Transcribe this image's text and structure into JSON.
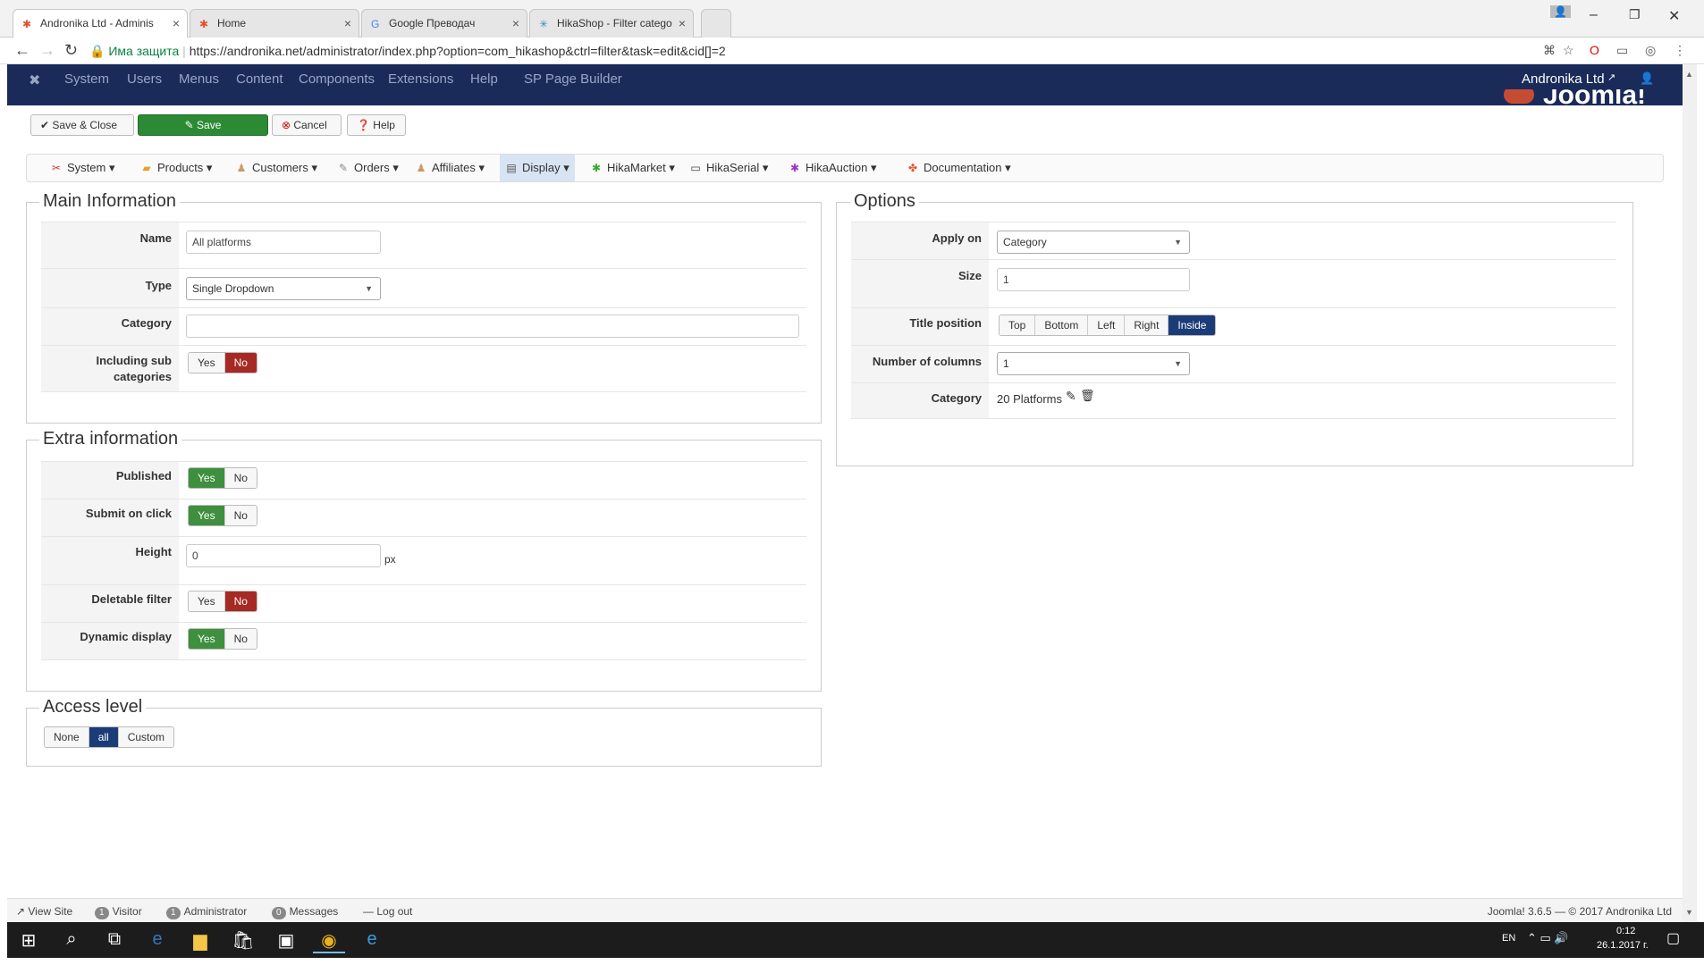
{
  "browser": {
    "tabs": [
      {
        "title": "Andronika Ltd - Adminis",
        "icon": "joomla-icon"
      },
      {
        "title": "Home",
        "icon": "joomla-icon"
      },
      {
        "title": "Google Преводач",
        "icon": "google-translate-icon"
      },
      {
        "title": "HikaShop - Filter catego",
        "icon": "hikashop-icon"
      }
    ],
    "security_label": "Има защита",
    "url": "https://andronika.net/administrator/index.php?option=com_hikashop&ctrl=filter&task=edit&cid[]=2"
  },
  "joomla_menu": {
    "items": [
      "System",
      "Users",
      "Menus",
      "Content",
      "Components",
      "Extensions",
      "Help",
      "SP Page Builder"
    ],
    "site_name": "Andronika Ltd"
  },
  "toolbar": {
    "save_close": "Save & Close",
    "save": "Save",
    "cancel": "Cancel",
    "help": "Help"
  },
  "hika_menu": {
    "items": [
      {
        "label": "System",
        "icon": "wrench-icon"
      },
      {
        "label": "Products",
        "icon": "products-icon"
      },
      {
        "label": "Customers",
        "icon": "customers-icon"
      },
      {
        "label": "Orders",
        "icon": "orders-icon"
      },
      {
        "label": "Affiliates",
        "icon": "affiliates-icon"
      },
      {
        "label": "Display",
        "icon": "display-icon"
      },
      {
        "label": "HikaMarket",
        "icon": "hikamarket-icon"
      },
      {
        "label": "HikaSerial",
        "icon": "hikaserial-icon"
      },
      {
        "label": "HikaAuction",
        "icon": "hikaauction-icon"
      },
      {
        "label": "Documentation",
        "icon": "documentation-icon"
      }
    ],
    "active": "Display"
  },
  "main_info": {
    "legend": "Main Information",
    "name_label": "Name",
    "name_value": "All platforms",
    "type_label": "Type",
    "type_value": "Single Dropdown",
    "category_label": "Category",
    "category_value": "",
    "subcat_label": "Including sub categories",
    "yes": "Yes",
    "no": "No"
  },
  "extra_info": {
    "legend": "Extra information",
    "published_label": "Published",
    "submit_label": "Submit on click",
    "height_label": "Height",
    "height_value": "0",
    "height_unit": "px",
    "deletable_label": "Deletable filter",
    "dynamic_label": "Dynamic display",
    "yes": "Yes",
    "no": "No"
  },
  "access": {
    "legend": "Access level",
    "options": [
      "None",
      "all",
      "Custom"
    ],
    "selected": "all"
  },
  "options": {
    "legend": "Options",
    "apply_label": "Apply on",
    "apply_value": "Category",
    "size_label": "Size",
    "size_value": "1",
    "title_pos_label": "Title position",
    "title_positions": [
      "Top",
      "Bottom",
      "Left",
      "Right",
      "Inside"
    ],
    "title_pos_selected": "Inside",
    "columns_label": "Number of columns",
    "columns_value": "1",
    "category_label": "Category",
    "category_value": "20 Platforms"
  },
  "statusbar": {
    "view_site": "View Site",
    "visitor_count": "1",
    "visitor": "Visitor",
    "admin_count": "1",
    "admin": "Administrator",
    "messages_count": "0",
    "messages": "Messages",
    "logout": "Log out",
    "version": "Joomla! 3.6.5 — © 2017 Andronika Ltd"
  },
  "taskbar": {
    "lang": "EN",
    "time": "0:12",
    "date": "26.1.2017 г."
  },
  "colors": {
    "joomla_bar": "#1a2b5a",
    "green": "#3e8f3e",
    "red": "#a72923",
    "blue": "#1c3c78"
  }
}
